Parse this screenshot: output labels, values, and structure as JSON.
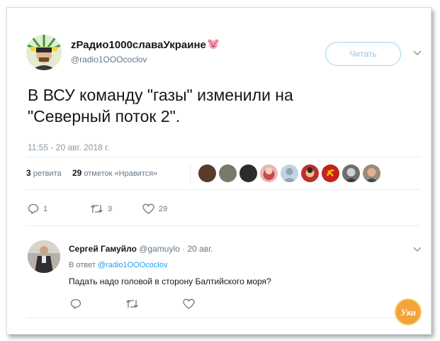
{
  "tweet": {
    "author_name": "zРадио1000славаУкраине",
    "author_handle": "@radio1OOOcoclov",
    "follow_label": "Читать",
    "text_line1": "В ВСУ команду \"газы\" изменили на",
    "text_line2": "\"Северный поток 2\".",
    "timestamp": "11:55 - 20 авг. 2018 г.",
    "retweets_count": "3",
    "retweets_label": "ретвита",
    "likes_count": "29",
    "likes_label": "отметок «Нравится»",
    "actions": {
      "reply_count": "1",
      "retweet_count": "3",
      "like_count": "29"
    }
  },
  "reply": {
    "author_name": "Сергей Гамуйло",
    "author_handle": "@gamuylo",
    "date": "· 20 авг.",
    "reply_to_prefix": "В ответ",
    "reply_to_handle": "@radio1OOOcoclov",
    "text": "Падать надо головой в сторону Балтийского моря?"
  },
  "colors": {
    "accent": "#1da1f2",
    "muted": "#657786",
    "text": "#14171a",
    "divider": "#e6ecf0",
    "follow_border": "#9fd0f0"
  },
  "icons": [
    "pig-emoji-icon",
    "chevron-down-icon",
    "reply-icon",
    "retweet-icon",
    "heart-icon",
    "watermark-logo"
  ],
  "watermark": {
    "text": "Ука"
  }
}
